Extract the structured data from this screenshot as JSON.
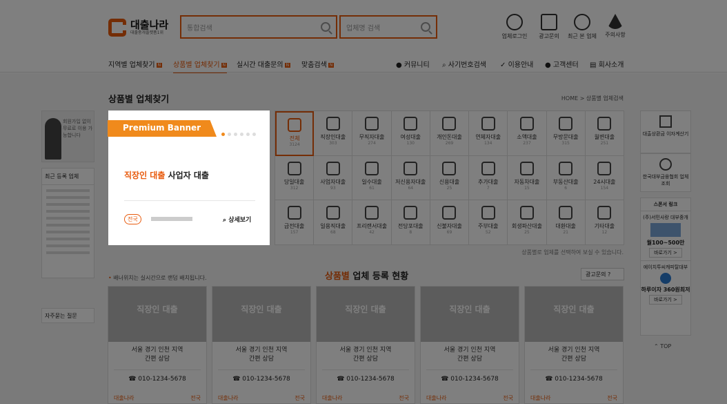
{
  "header": {
    "logo_text": "대출나라",
    "logo_sub": "대출중개플랫폼1위",
    "search_placeholder": "통합검색",
    "company_search_placeholder": "업체명 검색",
    "icons": [
      {
        "name": "user-icon",
        "label": "업체로그인"
      },
      {
        "name": "megaphone-icon",
        "label": "광고문의"
      },
      {
        "name": "clock-icon",
        "label": "최근 본 업체"
      },
      {
        "name": "warning-icon",
        "label": "주의사항"
      }
    ]
  },
  "nav": {
    "items": [
      "지역별 업체찾기",
      "상품별 업체찾기",
      "실시간 대출문의",
      "맞춤검색"
    ],
    "badge": "N",
    "right": [
      "커뮤니티",
      "사기번호검색",
      "이용안내",
      "고객센터",
      "회사소개"
    ]
  },
  "page": {
    "title": "상품별 업체찾기",
    "breadcrumb": "HOME > 상품별 업체검색"
  },
  "left": {
    "ad_text": "회원가입 없이 무료로 이용 가능합니다",
    "recent_title": "최근 등록 업체",
    "faq": "자주묻는 질문"
  },
  "banner": {
    "ribbon": "Premium Banner",
    "main_orange": "직장인 대출",
    "main_black": "사업자 대출",
    "region": "전국",
    "more": "상세보기"
  },
  "categories": [
    {
      "label": "전체",
      "count": "3124"
    },
    {
      "label": "직장인대출",
      "count": "303"
    },
    {
      "label": "무직자대출",
      "count": "274"
    },
    {
      "label": "여성대출",
      "count": "130"
    },
    {
      "label": "개인돈대출",
      "count": "269"
    },
    {
      "label": "연체자대출",
      "count": "134"
    },
    {
      "label": "소액대출",
      "count": "237"
    },
    {
      "label": "무방문대출",
      "count": "315"
    },
    {
      "label": "월변대출",
      "count": "251"
    },
    {
      "label": "당일대출",
      "count": "312"
    },
    {
      "label": "사업자대출",
      "count": "93"
    },
    {
      "label": "일수대출",
      "count": "61"
    },
    {
      "label": "저신용자대출",
      "count": "64"
    },
    {
      "label": "신용대출",
      "count": "25"
    },
    {
      "label": "추가대출",
      "count": "7"
    },
    {
      "label": "자동차대출",
      "count": "15"
    },
    {
      "label": "부동산대출",
      "count": "6"
    },
    {
      "label": "24시대출",
      "count": "154"
    },
    {
      "label": "급전대출",
      "count": "157"
    },
    {
      "label": "일용직대출",
      "count": "68"
    },
    {
      "label": "프리랜서대출",
      "count": "42"
    },
    {
      "label": "전당포대출",
      "count": "8"
    },
    {
      "label": "신불자대출",
      "count": "69"
    },
    {
      "label": "주부대출",
      "count": "52"
    },
    {
      "label": "회생파산대출",
      "count": "25"
    },
    {
      "label": "대환대출",
      "count": "21"
    },
    {
      "label": "기타대출",
      "count": "12"
    }
  ],
  "grid_note": "상품별로 업체를 선택하여 보실 수 있습니다.",
  "right": {
    "calc": "대출상환금 이자계산기",
    "assoc": "한국대부금융협회 업체조회",
    "sponsor_title": "스폰서 링크",
    "s1_name": "(주)서민사랑 대부중개",
    "s1_rate": "월100~500만",
    "s2_name": "에이치투씨캐피탈대부",
    "s2_rate": "하루이자 360원최저",
    "btn": "바로가기 >",
    "top": "TOP"
  },
  "products": {
    "note": "배너위치는 실시간으로 랜덤 배치됩니다.",
    "title_orange": "상품별",
    "title_rest": " 업체 등록 현황",
    "ad_btn": "광고문의",
    "cards": [
      {
        "title": "직장인 대출",
        "desc1": "서울 경기 인천 지역",
        "desc2": "간편 상담",
        "tel": "010-1234-5678",
        "owner": "대출나라",
        "region": "전국"
      },
      {
        "title": "직장인 대출",
        "desc1": "서울 경기 인천 지역",
        "desc2": "간편 상담",
        "tel": "010-1234-5678",
        "owner": "대출나라",
        "region": "전국"
      },
      {
        "title": "직장인 대출",
        "desc1": "서울 경기 인천 지역",
        "desc2": "간편 상담",
        "tel": "010-1234-5678",
        "owner": "대출나라",
        "region": "전국"
      },
      {
        "title": "직장인 대출",
        "desc1": "서울 경기 인천 지역",
        "desc2": "간편 상담",
        "tel": "010-1234-5678",
        "owner": "대출나라",
        "region": "전국"
      },
      {
        "title": "직장인 대출",
        "desc1": "서울 경기 인천 지역",
        "desc2": "간편 상담",
        "tel": "010-1234-5678",
        "owner": "대출나라",
        "region": "전국"
      }
    ]
  },
  "colors": {
    "accent": "#e85a0c",
    "overlay": "rgba(0,0,0,0.5)"
  }
}
